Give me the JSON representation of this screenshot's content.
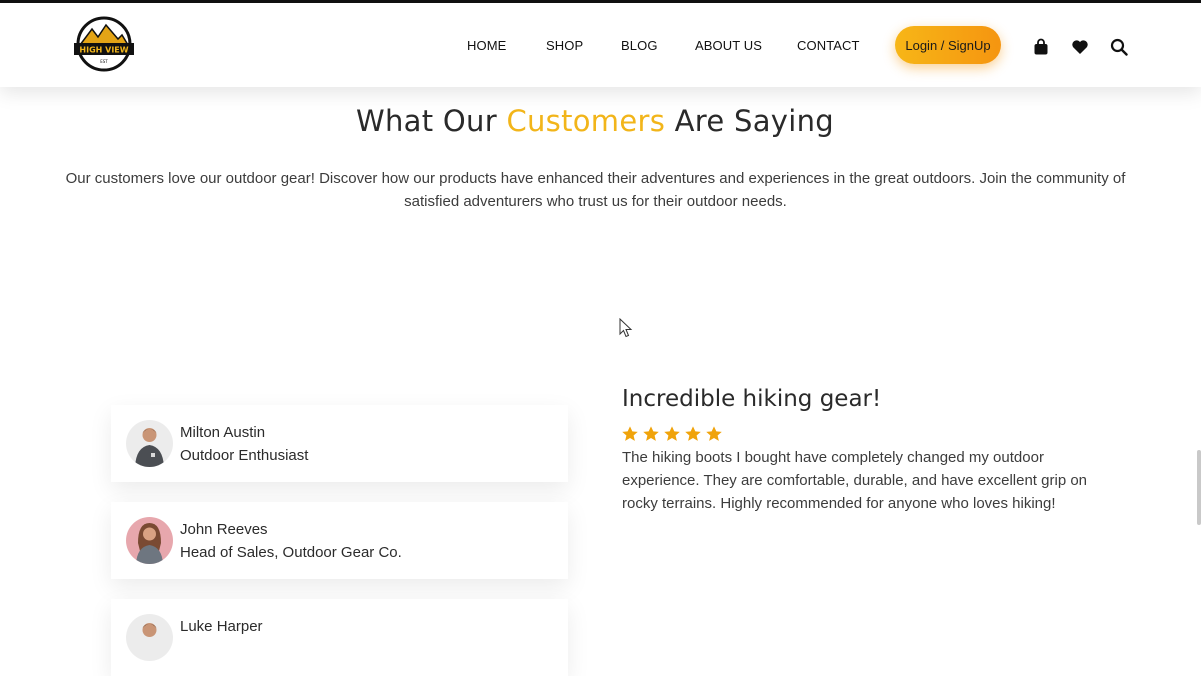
{
  "brand": {
    "logo_text": "HIGH VIEW",
    "logo_sub": "EST"
  },
  "nav": {
    "items": [
      {
        "label": "HOME"
      },
      {
        "label": "SHOP"
      },
      {
        "label": "BLOG"
      },
      {
        "label": "ABOUT US"
      },
      {
        "label": "CONTACT"
      }
    ],
    "login_label": "Login / SignUp",
    "icons": [
      "bag-icon",
      "heart-icon",
      "search-icon"
    ]
  },
  "section": {
    "title_before": "What Our ",
    "title_accent": "Customers",
    "title_after": " Are Saying",
    "intro": "Our customers love our outdoor gear! Discover how our products have enhanced their adventures and experiences in the great outdoors. Join the community of satisfied adventurers who trust us for their outdoor needs."
  },
  "testimonials": [
    {
      "name": "Milton Austin",
      "role": "Outdoor Enthusiast"
    },
    {
      "name": "John Reeves",
      "role": "Head of Sales, Outdoor Gear Co."
    },
    {
      "name": "Luke Harper",
      "role": ""
    }
  ],
  "review": {
    "title": "Incredible hiking gear!",
    "rating": 5,
    "max_rating": 5,
    "text": "The hiking boots I bought have completely changed my outdoor experience. They are comfortable, durable, and have excellent grip on rocky terrains. Highly recommended for anyone who loves hiking!"
  },
  "colors": {
    "accent": "#f2b51a",
    "button_start": "#f7b617",
    "button_end": "#f59510",
    "star": "#f0a30a"
  }
}
